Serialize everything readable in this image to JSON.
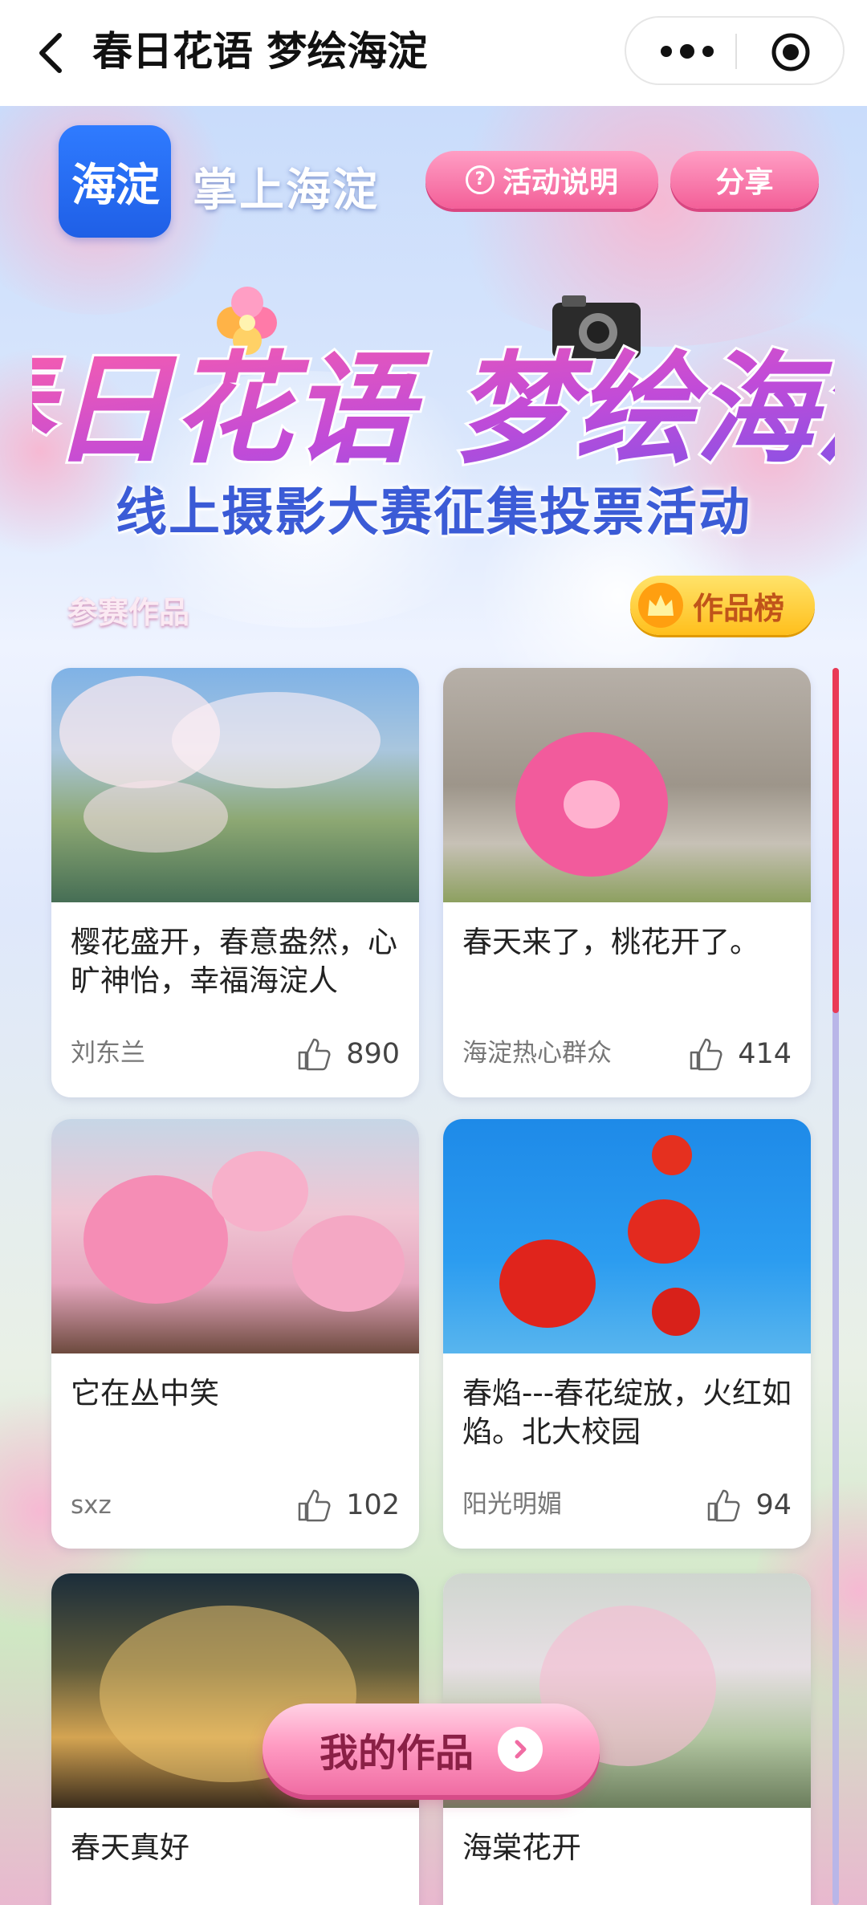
{
  "navbar": {
    "title": "春日花语 梦绘海淀",
    "back_icon": "chevron-left-icon",
    "more_icon": "more-dots-icon",
    "target_icon": "record-target-icon"
  },
  "header": {
    "logo_text": "海淀",
    "app_name": "掌上海淀",
    "rules_label": "活动说明",
    "share_label": "分享",
    "headline": "春日花语 梦绘海淀",
    "subtitle": "线上摄影大赛征集投票活动",
    "section_label": "参赛作品",
    "ranking_label": "作品榜"
  },
  "colors": {
    "accent_pink": "#f35f98",
    "title_blue": "#3b5bd6",
    "gold": "#ffbf1c",
    "scroll_thumb": "#ea3a55"
  },
  "entries": [
    {
      "title": "樱花盛开，春意盎然，心旷神怡，幸福海淀人",
      "author": "刘东兰",
      "likes": "890"
    },
    {
      "title": "春天来了，桃花开了。",
      "author": "海淀热心群众",
      "likes": "414"
    },
    {
      "title": "它在丛中笑",
      "author": "sxz",
      "likes": "102"
    },
    {
      "title": "春焰---春花绽放，火红如焰。北大校园",
      "author": "阳光明媚",
      "likes": "94"
    },
    {
      "title": "春天真好",
      "author": "",
      "likes": ""
    },
    {
      "title": "海棠花开",
      "author": "",
      "likes": ""
    }
  ],
  "footer": {
    "my_works_label": "我的作品"
  }
}
